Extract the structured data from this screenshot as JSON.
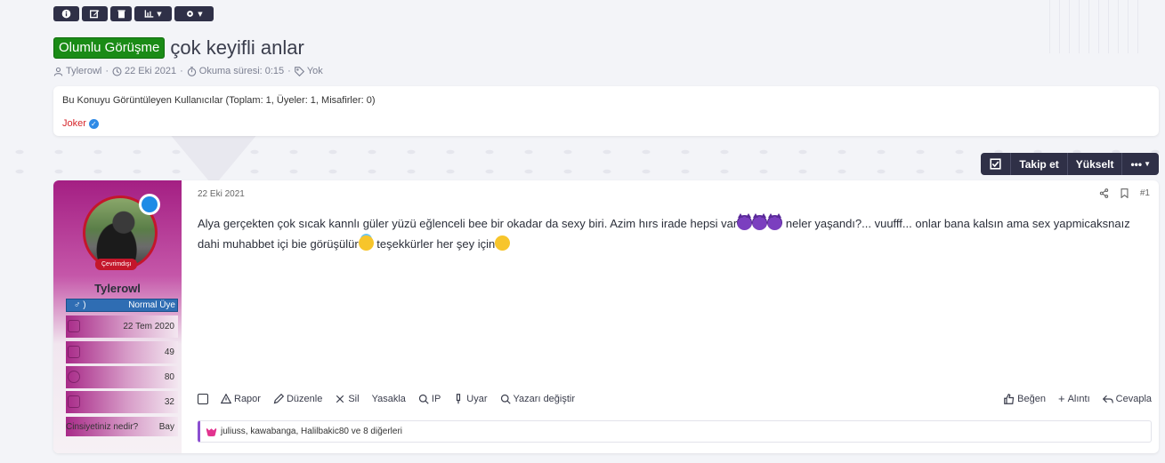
{
  "colors": {
    "accent": "#2f3047",
    "prefix": "#1a8b16",
    "username_red": "#d6262b",
    "rank_blue": "#2f6db3",
    "purple": "#a41f83"
  },
  "toolbar": {
    "buttons": [
      {
        "name": "info-icon"
      },
      {
        "name": "edit-icon"
      },
      {
        "name": "trash-icon"
      },
      {
        "name": "chart-icon",
        "has_caret": true
      },
      {
        "name": "gear-icon",
        "has_caret": true
      }
    ]
  },
  "thread": {
    "prefix": "Olumlu Görüşme",
    "title": "çok keyifli anlar",
    "author": "Tylerowl",
    "date": "22 Eki 2021",
    "read_time": "Okuma süresi: 0:15",
    "tags": "Yok"
  },
  "viewers": {
    "title": "Bu Konuyu Görüntüleyen Kullanıcılar (Toplam: 1, Üyeler: 1, Misafirler: 0)",
    "user": "Joker"
  },
  "actions": {
    "follow": "Takip et",
    "bump": "Yükselt",
    "more": "•••"
  },
  "post": {
    "user": {
      "name": "Tylerowl",
      "status": "Çevrimdışı",
      "gender_symbol": "♂ )",
      "rank": "Normal Üye",
      "joined": "22 Tem 2020",
      "messages": "49",
      "reactions": "80",
      "points": "32",
      "question": "Cinsiyetiniz nedir?",
      "answer": "Bay"
    },
    "date": "22 Eki 2021",
    "number": "#1",
    "body_part1": "Alya gerçekten çok sıcak kannlı güler yüzü eğlenceli bee bir okadar da sexy biri. Azim hırs irade hepsi var",
    "body_part2": " neler yaşandı?... vuufff... onlar bana kalsın ama sex yapmicaksnaız dahi muhabbet içi bie görüşülür",
    "body_part3": " teşekkürler her şey için",
    "footer": {
      "report": "Rapor",
      "edit": "Düzenle",
      "delete": "Sil",
      "ban": "Yasakla",
      "ip": "IP",
      "warn": "Uyar",
      "change_author": "Yazarı değiştir",
      "like": "Beğen",
      "quote": "Alıntı",
      "reply": "Cevapla"
    },
    "reactions_text": "juliuss, kawabanga, Halilbakic80 ve 8 diğerleri"
  }
}
